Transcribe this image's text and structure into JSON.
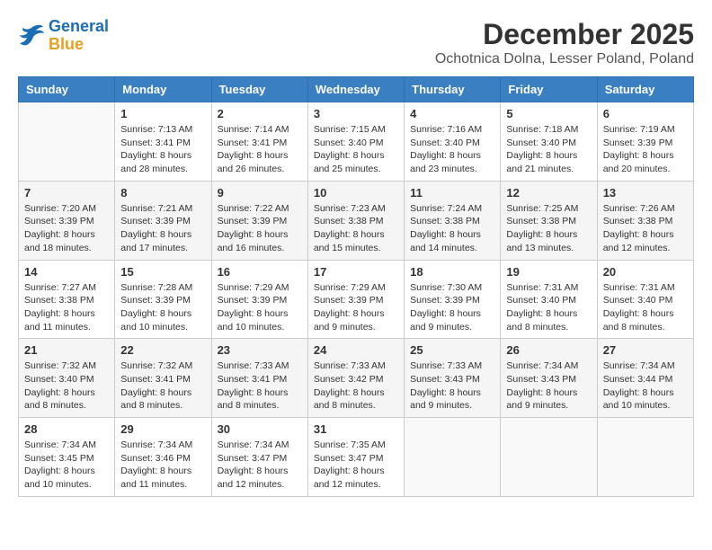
{
  "logo": {
    "line1": "General",
    "line2": "Blue"
  },
  "title": "December 2025",
  "location": "Ochotnica Dolna, Lesser Poland, Poland",
  "weekdays": [
    "Sunday",
    "Monday",
    "Tuesday",
    "Wednesday",
    "Thursday",
    "Friday",
    "Saturday"
  ],
  "weeks": [
    [
      {
        "day": "",
        "info": ""
      },
      {
        "day": "1",
        "info": "Sunrise: 7:13 AM\nSunset: 3:41 PM\nDaylight: 8 hours\nand 28 minutes."
      },
      {
        "day": "2",
        "info": "Sunrise: 7:14 AM\nSunset: 3:41 PM\nDaylight: 8 hours\nand 26 minutes."
      },
      {
        "day": "3",
        "info": "Sunrise: 7:15 AM\nSunset: 3:40 PM\nDaylight: 8 hours\nand 25 minutes."
      },
      {
        "day": "4",
        "info": "Sunrise: 7:16 AM\nSunset: 3:40 PM\nDaylight: 8 hours\nand 23 minutes."
      },
      {
        "day": "5",
        "info": "Sunrise: 7:18 AM\nSunset: 3:40 PM\nDaylight: 8 hours\nand 21 minutes."
      },
      {
        "day": "6",
        "info": "Sunrise: 7:19 AM\nSunset: 3:39 PM\nDaylight: 8 hours\nand 20 minutes."
      }
    ],
    [
      {
        "day": "7",
        "info": "Sunrise: 7:20 AM\nSunset: 3:39 PM\nDaylight: 8 hours\nand 18 minutes."
      },
      {
        "day": "8",
        "info": "Sunrise: 7:21 AM\nSunset: 3:39 PM\nDaylight: 8 hours\nand 17 minutes."
      },
      {
        "day": "9",
        "info": "Sunrise: 7:22 AM\nSunset: 3:39 PM\nDaylight: 8 hours\nand 16 minutes."
      },
      {
        "day": "10",
        "info": "Sunrise: 7:23 AM\nSunset: 3:38 PM\nDaylight: 8 hours\nand 15 minutes."
      },
      {
        "day": "11",
        "info": "Sunrise: 7:24 AM\nSunset: 3:38 PM\nDaylight: 8 hours\nand 14 minutes."
      },
      {
        "day": "12",
        "info": "Sunrise: 7:25 AM\nSunset: 3:38 PM\nDaylight: 8 hours\nand 13 minutes."
      },
      {
        "day": "13",
        "info": "Sunrise: 7:26 AM\nSunset: 3:38 PM\nDaylight: 8 hours\nand 12 minutes."
      }
    ],
    [
      {
        "day": "14",
        "info": "Sunrise: 7:27 AM\nSunset: 3:38 PM\nDaylight: 8 hours\nand 11 minutes."
      },
      {
        "day": "15",
        "info": "Sunrise: 7:28 AM\nSunset: 3:39 PM\nDaylight: 8 hours\nand 10 minutes."
      },
      {
        "day": "16",
        "info": "Sunrise: 7:29 AM\nSunset: 3:39 PM\nDaylight: 8 hours\nand 10 minutes."
      },
      {
        "day": "17",
        "info": "Sunrise: 7:29 AM\nSunset: 3:39 PM\nDaylight: 8 hours\nand 9 minutes."
      },
      {
        "day": "18",
        "info": "Sunrise: 7:30 AM\nSunset: 3:39 PM\nDaylight: 8 hours\nand 9 minutes."
      },
      {
        "day": "19",
        "info": "Sunrise: 7:31 AM\nSunset: 3:40 PM\nDaylight: 8 hours\nand 8 minutes."
      },
      {
        "day": "20",
        "info": "Sunrise: 7:31 AM\nSunset: 3:40 PM\nDaylight: 8 hours\nand 8 minutes."
      }
    ],
    [
      {
        "day": "21",
        "info": "Sunrise: 7:32 AM\nSunset: 3:40 PM\nDaylight: 8 hours\nand 8 minutes."
      },
      {
        "day": "22",
        "info": "Sunrise: 7:32 AM\nSunset: 3:41 PM\nDaylight: 8 hours\nand 8 minutes."
      },
      {
        "day": "23",
        "info": "Sunrise: 7:33 AM\nSunset: 3:41 PM\nDaylight: 8 hours\nand 8 minutes."
      },
      {
        "day": "24",
        "info": "Sunrise: 7:33 AM\nSunset: 3:42 PM\nDaylight: 8 hours\nand 8 minutes."
      },
      {
        "day": "25",
        "info": "Sunrise: 7:33 AM\nSunset: 3:43 PM\nDaylight: 8 hours\nand 9 minutes."
      },
      {
        "day": "26",
        "info": "Sunrise: 7:34 AM\nSunset: 3:43 PM\nDaylight: 8 hours\nand 9 minutes."
      },
      {
        "day": "27",
        "info": "Sunrise: 7:34 AM\nSunset: 3:44 PM\nDaylight: 8 hours\nand 10 minutes."
      }
    ],
    [
      {
        "day": "28",
        "info": "Sunrise: 7:34 AM\nSunset: 3:45 PM\nDaylight: 8 hours\nand 10 minutes."
      },
      {
        "day": "29",
        "info": "Sunrise: 7:34 AM\nSunset: 3:46 PM\nDaylight: 8 hours\nand 11 minutes."
      },
      {
        "day": "30",
        "info": "Sunrise: 7:34 AM\nSunset: 3:47 PM\nDaylight: 8 hours\nand 12 minutes."
      },
      {
        "day": "31",
        "info": "Sunrise: 7:35 AM\nSunset: 3:47 PM\nDaylight: 8 hours\nand 12 minutes."
      },
      {
        "day": "",
        "info": ""
      },
      {
        "day": "",
        "info": ""
      },
      {
        "day": "",
        "info": ""
      }
    ]
  ]
}
